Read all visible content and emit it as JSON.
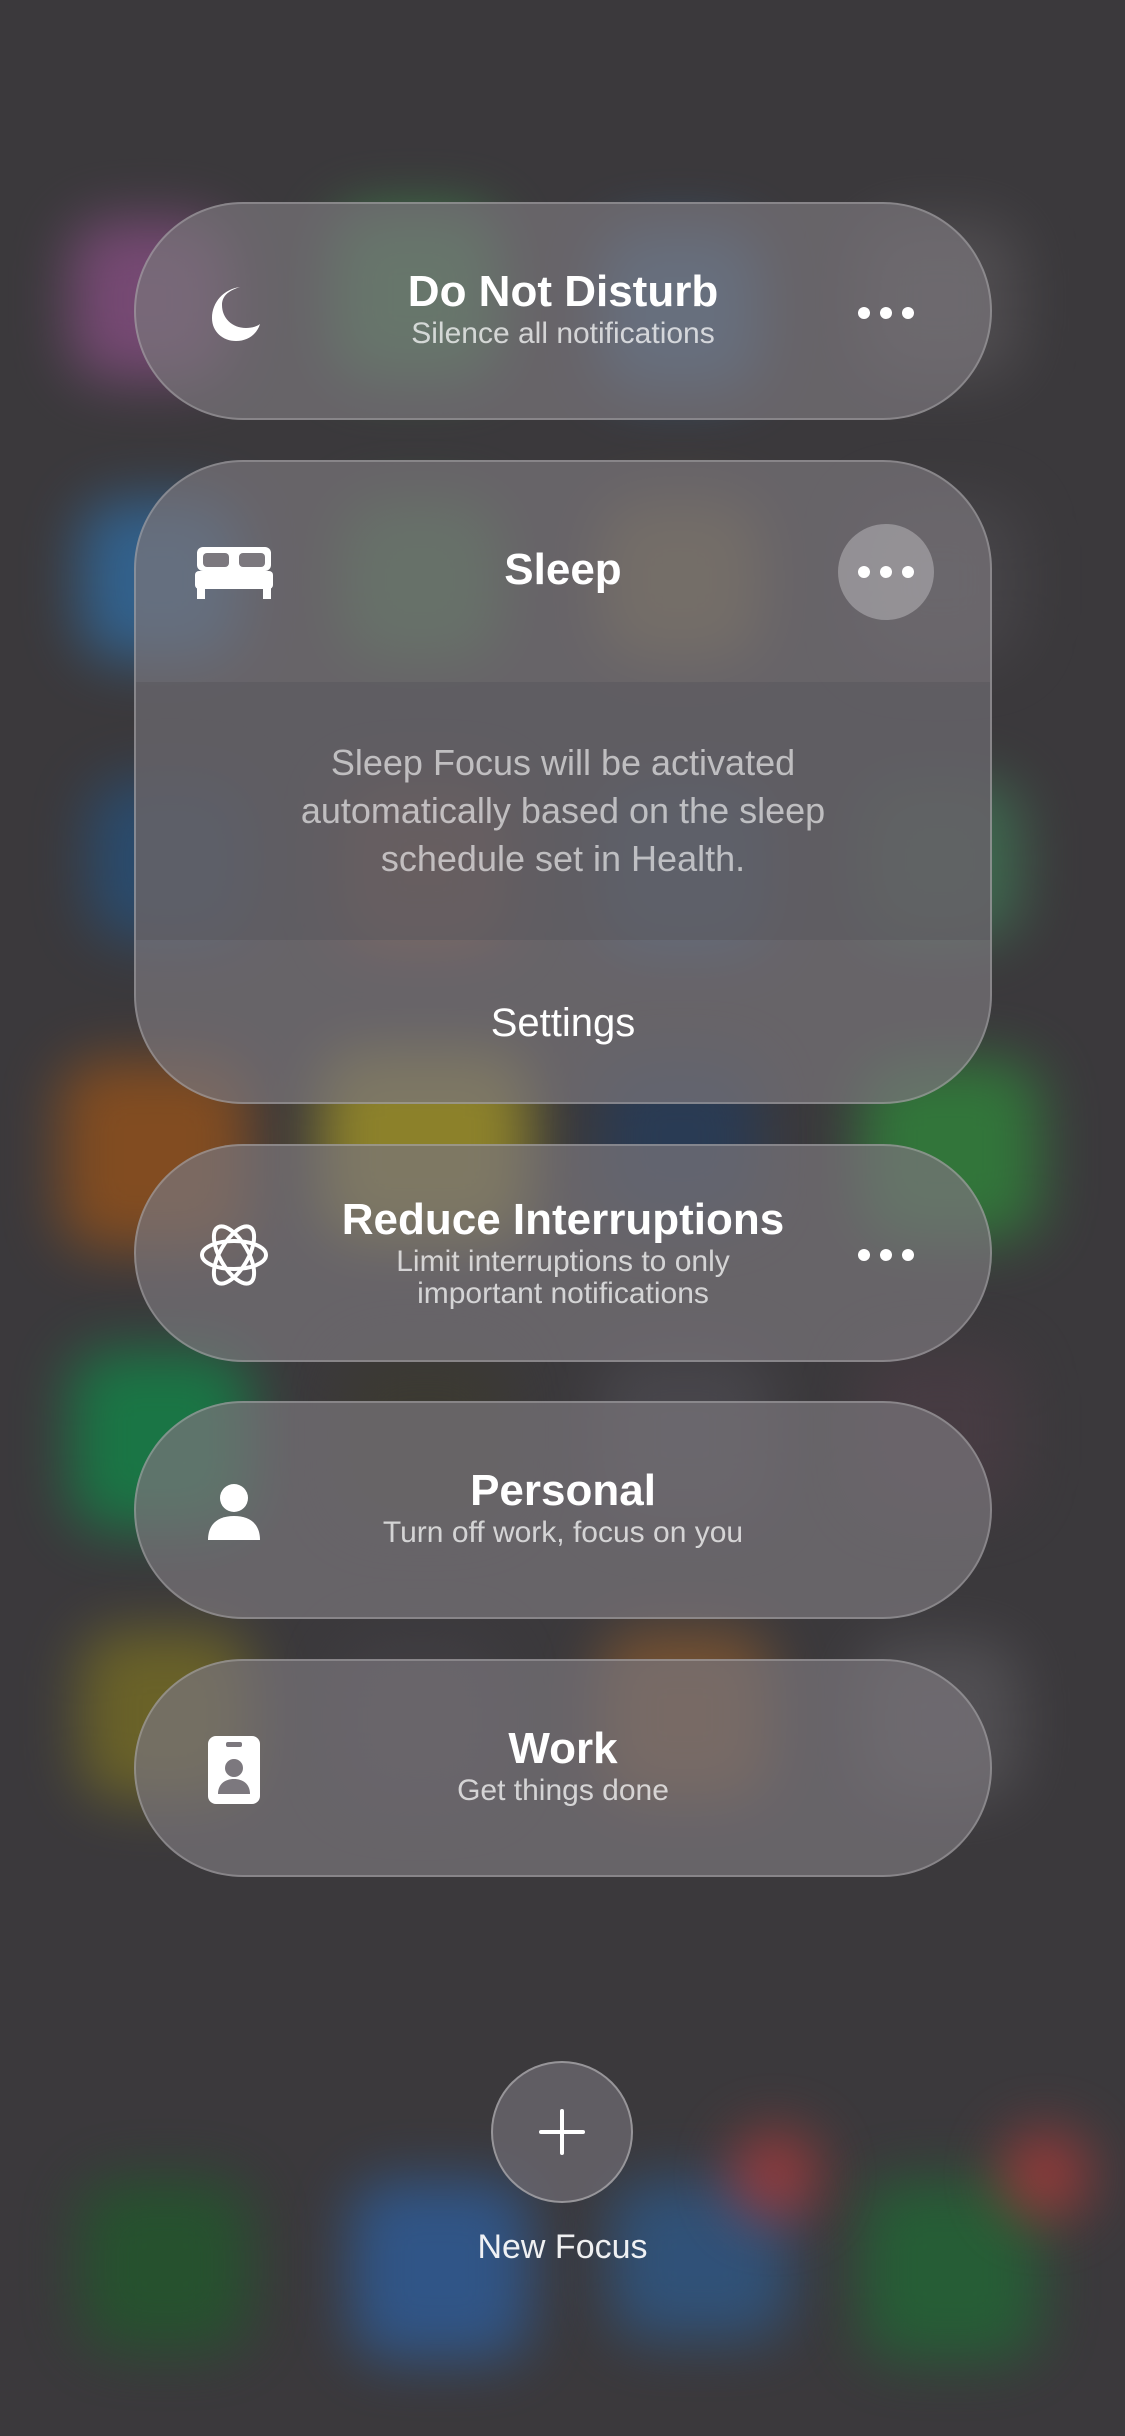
{
  "focus_modes": [
    {
      "id": "do-not-disturb",
      "title": "Do Not Disturb",
      "subtitle": "Silence all notifications",
      "icon": "moon-icon"
    },
    {
      "id": "sleep",
      "title": "Sleep",
      "icon": "bed-icon",
      "expanded": true,
      "description": "Sleep Focus will be activated automatically based on the sleep schedule set in Health.",
      "settings_label": "Settings"
    },
    {
      "id": "reduce-interruptions",
      "title": "Reduce Interruptions",
      "subtitle_line1": "Limit interruptions to only",
      "subtitle_line2": "important notifications",
      "icon": "sparkle-icon"
    },
    {
      "id": "personal",
      "title": "Personal",
      "subtitle": "Turn off work, focus on you",
      "icon": "person-icon"
    },
    {
      "id": "work",
      "title": "Work",
      "subtitle": "Get things done",
      "icon": "id-badge-icon"
    }
  ],
  "new_focus": {
    "label": "New Focus",
    "icon": "plus-icon"
  },
  "colors": {
    "background": "#3b393c",
    "card": "#78747a",
    "text": "#ffffff"
  }
}
